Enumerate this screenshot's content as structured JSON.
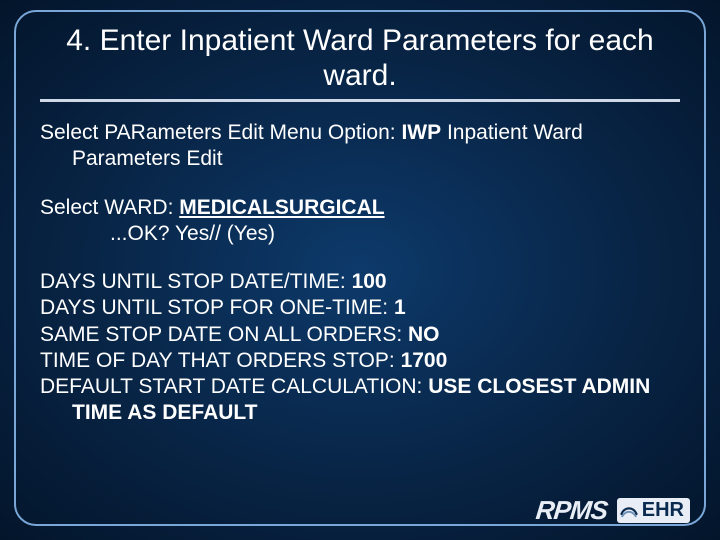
{
  "title": "4. Enter Inpatient Ward Parameters for each ward.",
  "p1": {
    "lead": "Select PARameters Edit Menu Option: ",
    "code": "IWP",
    "tail": "  Inpatient Ward Parameters Edit"
  },
  "p2": {
    "line1_lead": "Select WARD: ",
    "line1_val": "MEDICALSURGICAL",
    "line2": "...OK? Yes//   (Yes)"
  },
  "fields": [
    {
      "label": "DAYS UNTIL STOP DATE/TIME: ",
      "value": "100"
    },
    {
      "label": "DAYS UNTIL STOP FOR ONE-TIME: ",
      "value": "1"
    },
    {
      "label": "SAME STOP DATE ON ALL ORDERS: ",
      "value": "NO"
    },
    {
      "label": "TIME OF DAY THAT ORDERS STOP: ",
      "value": "1700"
    },
    {
      "label": "DEFAULT START DATE CALCULATION: ",
      "value": "USE CLOSEST ADMIN TIME AS DEFAULT"
    }
  ],
  "footer": {
    "rpms": "RPMS",
    "ehr": "EHR"
  }
}
